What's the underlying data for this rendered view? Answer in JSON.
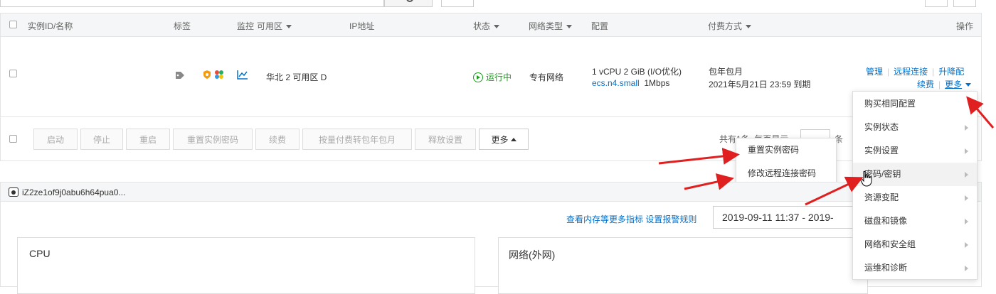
{
  "table": {
    "headers": {
      "instance": "实例ID/名称",
      "tags": "标签",
      "monitor": "监控",
      "zone": "可用区",
      "ip": "IP地址",
      "status": "状态",
      "network_type": "网络类型",
      "config": "配置",
      "billing": "付费方式",
      "actions": "操作"
    },
    "row": {
      "zone": "华北 2 可用区 D",
      "status": "运行中",
      "network_type": "专有网络",
      "config_line1": "1 vCPU 2 GiB (I/O优化)",
      "config_type": "ecs.n4.small",
      "config_bandwidth": "1Mbps",
      "billing_line1": "包年包月",
      "billing_line2": "2021年5月21日 23:59 到期",
      "actions": {
        "manage": "管理",
        "remote": "远程连接",
        "upgrade": "升降配",
        "renew": "续费",
        "more": "更多"
      }
    }
  },
  "toolbar": {
    "start": "启动",
    "stop": "停止",
    "restart": "重启",
    "reset_password": "重置实例密码",
    "renew": "续费",
    "convert": "按量付费转包年包月",
    "release": "释放设置",
    "more": "更多",
    "pagination_text": "共有1条, 每页显示",
    "pagination_suffix": "条"
  },
  "submenu": {
    "items": [
      "重置实例密码",
      "修改远程连接密码"
    ]
  },
  "more_menu": {
    "items": [
      {
        "label": "购买相同配置",
        "has_sub": false
      },
      {
        "label": "实例状态",
        "has_sub": true
      },
      {
        "label": "实例设置",
        "has_sub": true
      },
      {
        "label": "密码/密钥",
        "has_sub": true
      },
      {
        "label": "资源变配",
        "has_sub": true
      },
      {
        "label": "磁盘和镜像",
        "has_sub": true
      },
      {
        "label": "网络和安全组",
        "has_sub": true
      },
      {
        "label": "运维和诊断",
        "has_sub": true
      }
    ]
  },
  "monitor": {
    "instance_id": "iZ2ze1of9j0abu6h64pua0...",
    "more_metrics": "查看内存等更多指标",
    "alarm_rules": "设置报警规则",
    "date_range": "2019-09-11 11:37  -  2019-",
    "cpu_title": "CPU",
    "network_title": "网络(外网)"
  },
  "colors": {
    "link": "#0070cc",
    "running": "#1a9e1a",
    "arrow": "#e02020"
  }
}
